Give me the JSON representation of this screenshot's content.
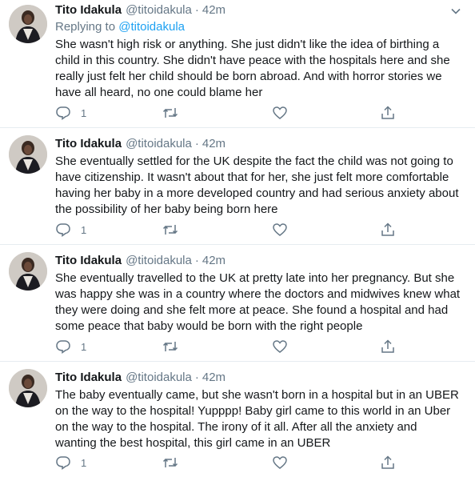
{
  "tweets": [
    {
      "name": "Tito Idakula",
      "handle": "@titoidakula",
      "separator": "·",
      "time": "42m",
      "replying_prefix": "Replying to",
      "replying_to": "@titoidakula",
      "text": "She wasn't high risk or anything. She just didn't like the idea of birthing a\nchild in this country. She didn't have peace with the hospitals here and she\nreally just felt her child should be born abroad. And with horror stories we\nhave all heard, no one could blame her",
      "reply_count": "1"
    },
    {
      "name": "Tito Idakula",
      "handle": "@titoidakula",
      "separator": "·",
      "time": "42m",
      "text": "She eventually settled for the UK despite the fact the child was not going to\nhave citizenship. It wasn't about that for her, she just felt more comfortable\nhaving her baby in a more developed country and had serious anxiety about\nthe possibility of her baby being born here",
      "reply_count": "1"
    },
    {
      "name": "Tito Idakula",
      "handle": "@titoidakula",
      "separator": "·",
      "time": "42m",
      "text": "She eventually travelled to the UK at pretty late into her pregnancy. But she\nwas happy she was in a country where the doctors and midwives knew what\nthey were doing and she felt more at peace. She found a hospital and had\nsome peace that baby would be born with the right people",
      "reply_count": "1"
    },
    {
      "name": "Tito Idakula",
      "handle": "@titoidakula",
      "separator": "·",
      "time": "42m",
      "text": "The baby eventually came, but she wasn't born in a hospital but in an UBER\non the way to the hospital! Yupppp! Baby girl came to this world in an Uber\non the way to the hospital. The irony of it all. After all the anxiety and\nwanting the best hospital, this girl came in an UBER",
      "reply_count": "1"
    }
  ],
  "colors": {
    "text": "#14171a",
    "secondary": "#657786",
    "link": "#1da1f2",
    "divider": "#e6ecf0"
  },
  "icons": [
    "avatar",
    "caret-down-icon",
    "reply-icon",
    "retweet-icon",
    "like-icon",
    "share-icon"
  ]
}
